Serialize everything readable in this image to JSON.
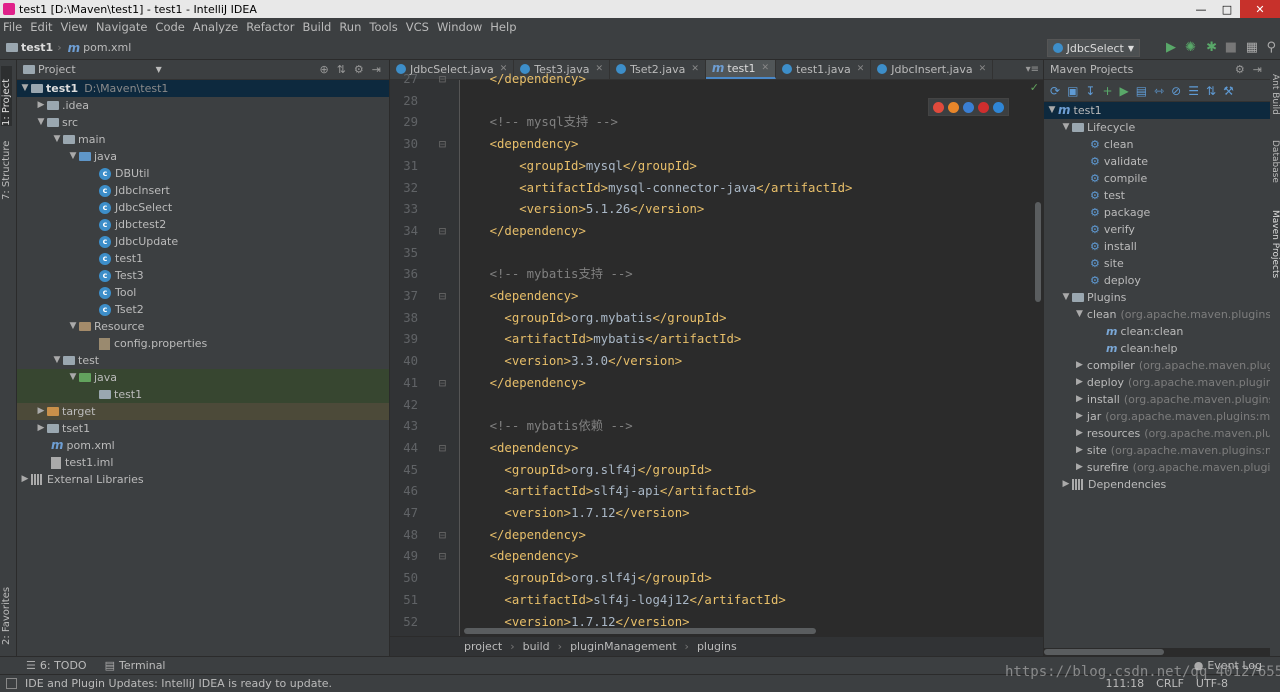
{
  "window": {
    "title": "test1 [D:\\Maven\\test1] - test1 - IntelliJ IDEA"
  },
  "menu": [
    "File",
    "Edit",
    "View",
    "Navigate",
    "Code",
    "Analyze",
    "Refactor",
    "Build",
    "Run",
    "Tools",
    "VCS",
    "Window",
    "Help"
  ],
  "nav": {
    "project": "test1",
    "file": "pom.xml",
    "run_config": "JdbcSelect"
  },
  "left_stripe": {
    "project": "1: Project",
    "structure": "7: Structure",
    "favorites": "2: Favorites"
  },
  "project_panel": {
    "title": "Project",
    "root": "test1",
    "root_path": "D:\\Maven\\test1",
    "rows": [
      "test1",
      ".idea",
      "src",
      "main",
      "java",
      "DBUtil",
      "JdbcInsert",
      "JdbcSelect",
      "jdbctest2",
      "JdbcUpdate",
      "test1",
      "Test3",
      "Tool",
      "Tset2",
      "Resource",
      "config.properties",
      "test",
      "java",
      "test1",
      "target",
      "tset1",
      "pom.xml",
      "test1.iml",
      "External Libraries"
    ]
  },
  "editor": {
    "tabs": [
      "JdbcSelect.java",
      "Test3.java",
      "Tset2.java",
      "test1",
      "test1.java",
      "JdbcInsert.java"
    ],
    "lines": [
      {
        "n": "27",
        "t": "    </dependency>"
      },
      {
        "n": "28",
        "t": ""
      },
      {
        "n": "29",
        "t": "    <!-- mysql支持 -->"
      },
      {
        "n": "30",
        "t": "    <dependency>"
      },
      {
        "n": "31",
        "t": "        <groupId>mysql</groupId>"
      },
      {
        "n": "32",
        "t": "        <artifactId>mysql-connector-java</artifactId>"
      },
      {
        "n": "33",
        "t": "        <version>5.1.26</version>"
      },
      {
        "n": "34",
        "t": "    </dependency>"
      },
      {
        "n": "35",
        "t": ""
      },
      {
        "n": "36",
        "t": "    <!-- mybatis支持 -->"
      },
      {
        "n": "37",
        "t": "    <dependency>"
      },
      {
        "n": "38",
        "t": "      <groupId>org.mybatis</groupId>"
      },
      {
        "n": "39",
        "t": "      <artifactId>mybatis</artifactId>"
      },
      {
        "n": "40",
        "t": "      <version>3.3.0</version>"
      },
      {
        "n": "41",
        "t": "    </dependency>"
      },
      {
        "n": "42",
        "t": ""
      },
      {
        "n": "43",
        "t": "    <!-- mybatis依赖 -->"
      },
      {
        "n": "44",
        "t": "    <dependency>"
      },
      {
        "n": "45",
        "t": "      <groupId>org.slf4j</groupId>"
      },
      {
        "n": "46",
        "t": "      <artifactId>slf4j-api</artifactId>"
      },
      {
        "n": "47",
        "t": "      <version>1.7.12</version>"
      },
      {
        "n": "48",
        "t": "    </dependency>"
      },
      {
        "n": "49",
        "t": "    <dependency>"
      },
      {
        "n": "50",
        "t": "      <groupId>org.slf4j</groupId>"
      },
      {
        "n": "51",
        "t": "      <artifactId>slf4j-log4j12</artifactId>"
      },
      {
        "n": "52",
        "t": "      <version>1.7.12</version>"
      }
    ],
    "breadcrumbs": [
      "project",
      "build",
      "pluginManagement",
      "plugins"
    ]
  },
  "maven": {
    "title": "Maven Projects",
    "root": "test1",
    "lifecycle_label": "Lifecycle",
    "lifecycle": [
      "clean",
      "validate",
      "compile",
      "test",
      "package",
      "verify",
      "install",
      "site",
      "deploy"
    ],
    "plugins_label": "Plugins",
    "plugins": [
      {
        "name": "clean",
        "group": "(org.apache.maven.plugins:m"
      },
      {
        "name": "compiler",
        "group": "(org.apache.maven.plugi"
      },
      {
        "name": "deploy",
        "group": "(org.apache.maven.plugins"
      },
      {
        "name": "install",
        "group": "(org.apache.maven.plugins:r"
      },
      {
        "name": "jar",
        "group": "(org.apache.maven.plugins:mav"
      },
      {
        "name": "resources",
        "group": "(org.apache.maven.plug"
      },
      {
        "name": "site",
        "group": "(org.apache.maven.plugins:ma"
      },
      {
        "name": "surefire",
        "group": "(org.apache.maven.plugin"
      }
    ],
    "clean_goals": [
      "clean:clean",
      "clean:help"
    ],
    "dependencies_label": "Dependencies"
  },
  "right_stripe": {
    "ant": "Ant Build",
    "database": "Database",
    "maven": "Maven Projects"
  },
  "bottom": {
    "todo": "6: TODO",
    "terminal": "Terminal",
    "event_log": "Event Log"
  },
  "status": {
    "message": "IDE and Plugin Updates: IntelliJ IDEA is ready to update.",
    "position": "111:18",
    "line_sep": "CRLF",
    "encoding": "UTF-8"
  },
  "watermark": "https://blog.csdn.net/qq_40127655"
}
